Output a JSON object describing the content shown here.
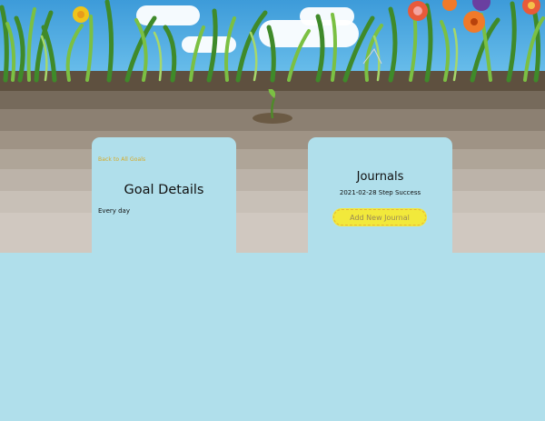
{
  "goal": {
    "back_link": "Back to All Goals",
    "title": "Goal Details",
    "frequency": "Every day"
  },
  "journals": {
    "title": "Journals",
    "entries": [
      {
        "text": "2021-02-28 Step Success"
      }
    ],
    "add_button": "Add New Journal"
  },
  "colors": {
    "page_background": "#b0dfeb",
    "soil_dark": "#5e503f",
    "soil_light": "#d0c8c0",
    "link": "#d6a924",
    "button": "#f2e93b"
  }
}
